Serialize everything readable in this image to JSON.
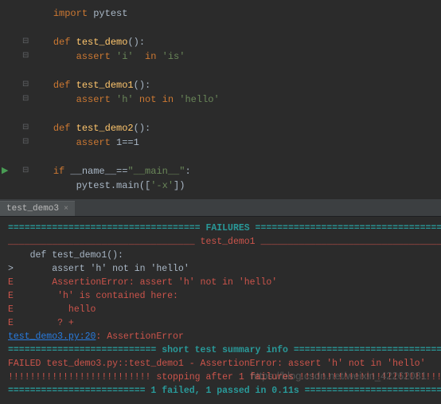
{
  "editor": {
    "lines": [
      {
        "indent": "    ",
        "tokens": [
          {
            "t": "import ",
            "c": "kw"
          },
          {
            "t": "pytest",
            "c": ""
          }
        ]
      },
      {
        "indent": "",
        "tokens": []
      },
      {
        "fold": "⊟",
        "indent": "    ",
        "tokens": [
          {
            "t": "def ",
            "c": "kw"
          },
          {
            "t": "test_demo",
            "c": "fn"
          },
          {
            "t": "():",
            "c": ""
          }
        ]
      },
      {
        "fold": "⊟",
        "indent": "        ",
        "tokens": [
          {
            "t": "assert ",
            "c": "kw"
          },
          {
            "t": "'i'  ",
            "c": "str"
          },
          {
            "t": "in ",
            "c": "kw"
          },
          {
            "t": "'is'",
            "c": "str"
          }
        ]
      },
      {
        "indent": "",
        "tokens": []
      },
      {
        "fold": "⊟",
        "indent": "    ",
        "tokens": [
          {
            "t": "def ",
            "c": "kw"
          },
          {
            "t": "test_demo1",
            "c": "fn"
          },
          {
            "t": "():",
            "c": ""
          }
        ]
      },
      {
        "fold": "⊟",
        "indent": "        ",
        "tokens": [
          {
            "t": "assert ",
            "c": "kw"
          },
          {
            "t": "'h' ",
            "c": "str"
          },
          {
            "t": "not in ",
            "c": "kw"
          },
          {
            "t": "'hello'",
            "c": "str"
          }
        ]
      },
      {
        "indent": "",
        "tokens": []
      },
      {
        "fold": "⊟",
        "indent": "    ",
        "tokens": [
          {
            "t": "def ",
            "c": "kw"
          },
          {
            "t": "test_demo2",
            "c": "fn"
          },
          {
            "t": "():",
            "c": ""
          }
        ]
      },
      {
        "fold": "⊟",
        "indent": "        ",
        "tokens": [
          {
            "t": "assert ",
            "c": "kw"
          },
          {
            "t": "1==1",
            "c": ""
          }
        ]
      },
      {
        "indent": "",
        "tokens": []
      },
      {
        "run": true,
        "fold": "⊟",
        "indent": "    ",
        "tokens": [
          {
            "t": "if ",
            "c": "kw"
          },
          {
            "t": "__name__==",
            "c": ""
          },
          {
            "t": "\"__main__\"",
            "c": "str"
          },
          {
            "t": ":",
            "c": ""
          }
        ]
      },
      {
        "indent": "        ",
        "tokens": [
          {
            "t": "pytest.main([",
            "c": ""
          },
          {
            "t": "'-x'",
            "c": "str"
          },
          {
            "t": "])",
            "c": ""
          }
        ]
      }
    ]
  },
  "tab": {
    "label": "test_demo3",
    "close": "×"
  },
  "console": {
    "lines": [
      {
        "c": "cyan",
        "t": "=================================== FAILURES =================================="
      },
      {
        "c": "red",
        "t": "__________________________________ test_demo1 __________________________________"
      },
      {
        "c": "",
        "t": ""
      },
      {
        "c": "",
        "t": "    def test_demo1():"
      },
      {
        "c": "",
        "t": ">       assert 'h' not in 'hello'"
      },
      {
        "c": "red",
        "t": "E       AssertionError: assert 'h' not in 'hello'"
      },
      {
        "c": "red",
        "t": "E        'h' is contained here:"
      },
      {
        "c": "red",
        "t": "E          hello"
      },
      {
        "c": "red",
        "t": "E        ? +"
      },
      {
        "c": "",
        "t": ""
      },
      {
        "link": "test_demo3.py:20",
        "tail": ": AssertionError"
      },
      {
        "c": "cyan",
        "t": "=========================== short test summary info ==========================="
      },
      {
        "c": "red",
        "t": "FAILED test_demo3.py::test_demo1 - AssertionError: assert 'h' not in 'hello'"
      },
      {
        "c": "red",
        "t": "!!!!!!!!!!!!!!!!!!!!!!!!!! stopping after 1 failures !!!!!!!!!!!!!!!!!!!!!!!!!!"
      },
      {
        "c": "cyan",
        "t": "========================= 1 failed, 1 passed in 0.11s ========================="
      }
    ]
  },
  "watermark": "https://blog.csdn.net/weixin_42262081"
}
